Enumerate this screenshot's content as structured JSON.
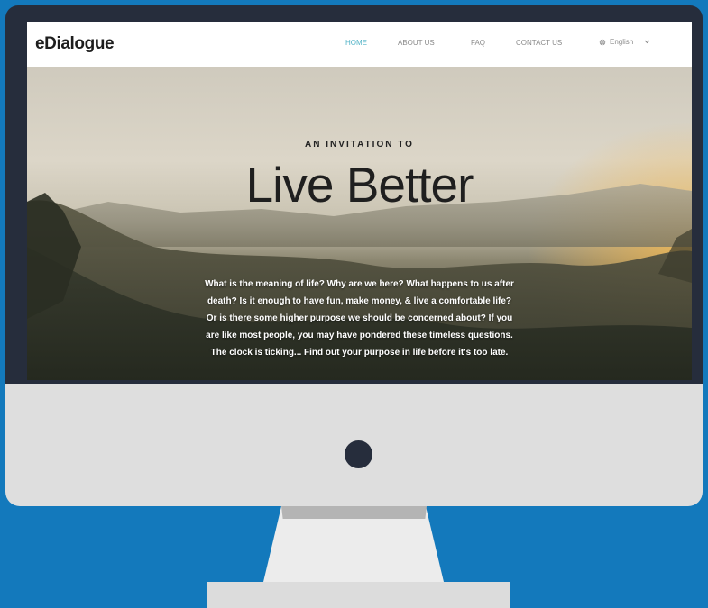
{
  "site": {
    "logo": "eDialogue"
  },
  "nav": {
    "items": [
      {
        "label": "HOME",
        "active": true
      },
      {
        "label": "ABOUT US",
        "active": false
      },
      {
        "label": "FAQ",
        "active": false
      },
      {
        "label": "CONTACT US",
        "active": false
      }
    ],
    "language": {
      "label": "English",
      "icon": "globe-icon",
      "caret": "chevron-down-icon"
    }
  },
  "hero": {
    "subtitle": "AN INVITATION TO",
    "headline": "Live Better",
    "lines": [
      "What is the meaning of life? Why are we here? What happens to us after",
      "death? Is it enough to have fun, make money, & live a comfortable life?",
      "Or is there some higher purpose we should be concerned about? If you",
      "are like most people, you may have pondered these timeless questions.",
      "The clock is ticking... Find out your purpose in life before it's too late."
    ]
  },
  "colors": {
    "background": "#1379bc",
    "bezel": "#262d3c",
    "chin": "#dedede",
    "accent": "#52b3c7"
  }
}
